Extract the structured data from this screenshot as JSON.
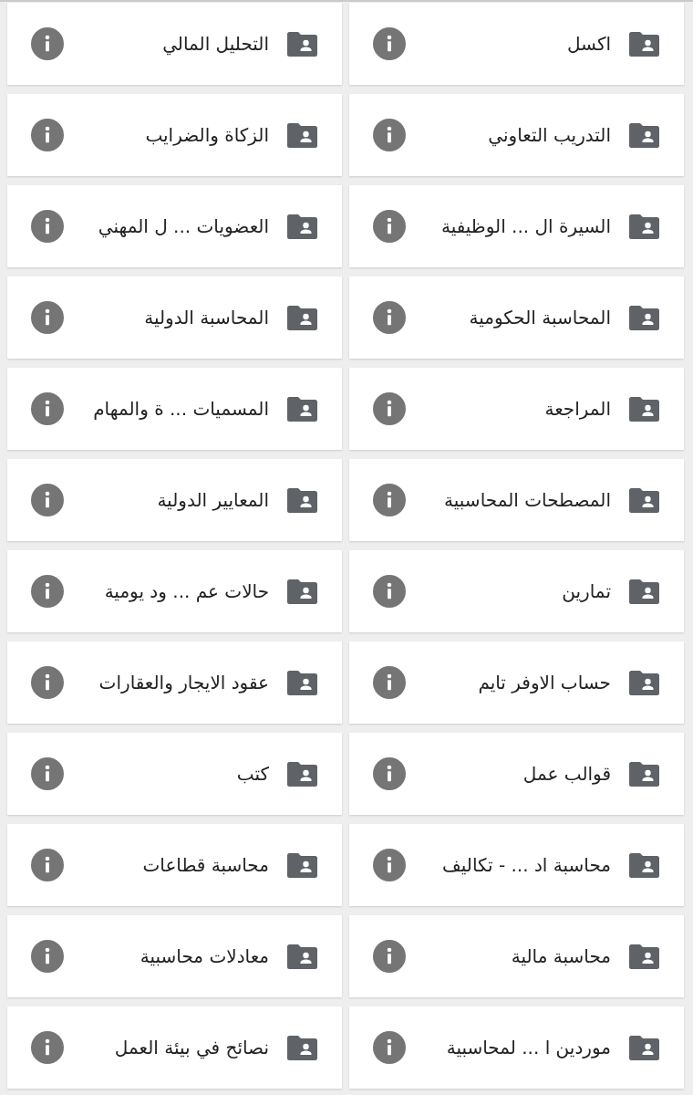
{
  "folders": [
    {
      "name": "اكسل"
    },
    {
      "name": "التحليل المالي"
    },
    {
      "name": "التدريب التعاوني"
    },
    {
      "name": "الزكاة والضرايب"
    },
    {
      "name": "السيرة ال ... الوظيفية"
    },
    {
      "name": "العضويات ... ل المهني"
    },
    {
      "name": "المحاسبة الحكومية"
    },
    {
      "name": "المحاسبة الدولية"
    },
    {
      "name": "المراجعة"
    },
    {
      "name": "المسميات ... ة والمهام"
    },
    {
      "name": "المصطحات المحاسبية"
    },
    {
      "name": "المعايير الدولية"
    },
    {
      "name": "تمارين"
    },
    {
      "name": "حالات عم ... ود يومية"
    },
    {
      "name": "حساب الاوفر تايم"
    },
    {
      "name": "عقود الايجار والعقارات"
    },
    {
      "name": "قوالب عمل"
    },
    {
      "name": "كتب"
    },
    {
      "name": "محاسبة اد ... - تكاليف"
    },
    {
      "name": "محاسبة قطاعات"
    },
    {
      "name": "محاسبة مالية"
    },
    {
      "name": "معادلات محاسبية"
    },
    {
      "name": "موردين ا ... لمحاسبية"
    },
    {
      "name": "نصائح في بيئة العمل"
    }
  ]
}
